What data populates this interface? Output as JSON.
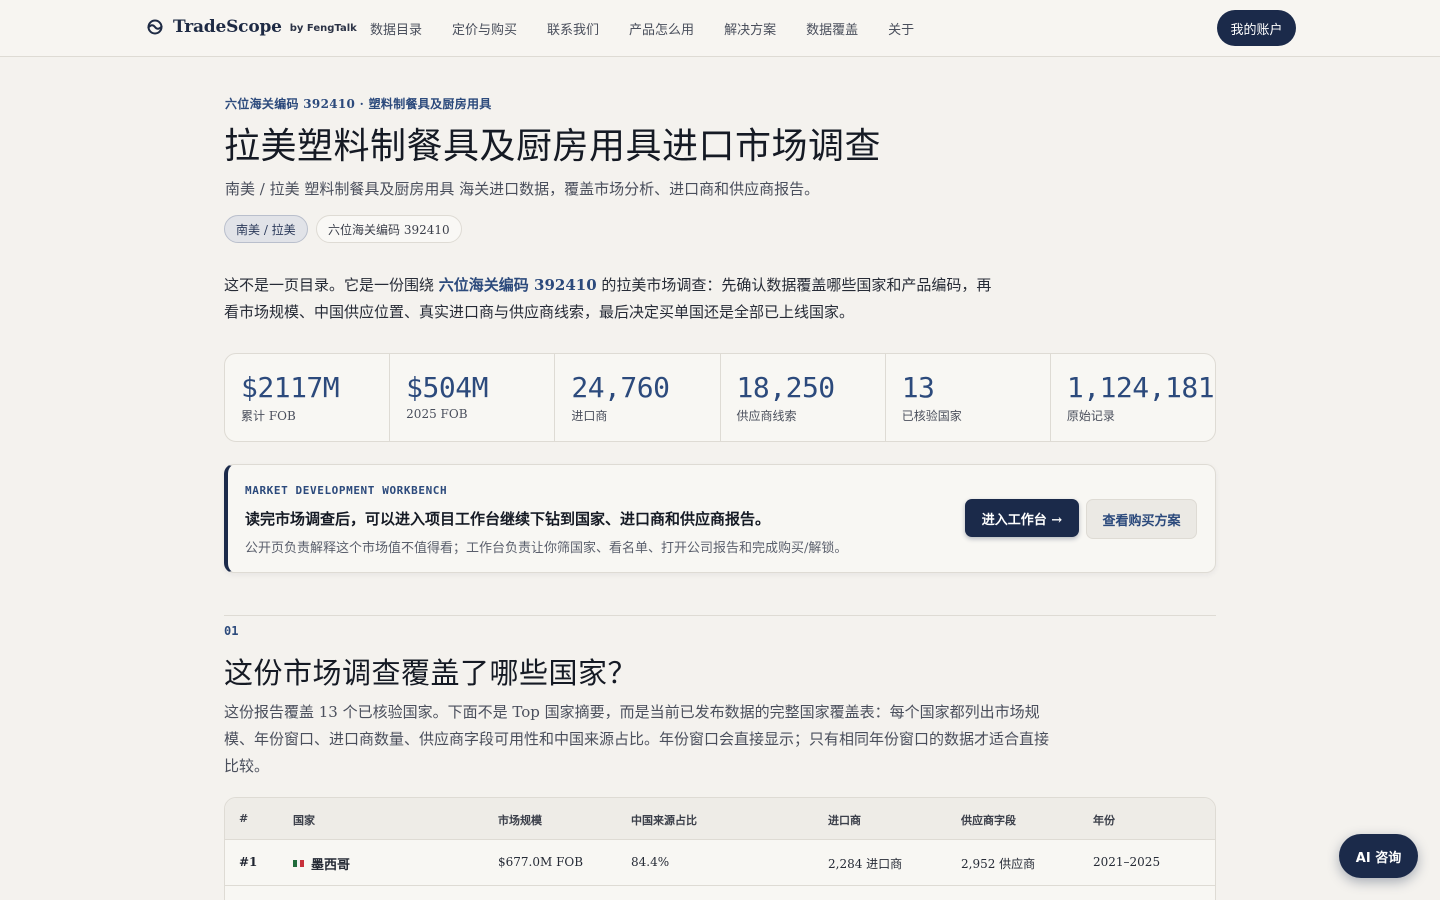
{
  "nav": {
    "brand": "TradeScope",
    "brand_by": "by FengTalk",
    "links": [
      "数据目录",
      "定价与购买",
      "联系我们",
      "产品怎么用",
      "解决方案",
      "数据覆盖",
      "关于"
    ],
    "account": "我的账户"
  },
  "hero": {
    "eyebrow": "六位海关编码 392410 · 塑料制餐具及厨房用具",
    "title": "拉美塑料制餐具及厨房用具进口市场调查",
    "subtitle": "南美 / 拉美 塑料制餐具及厨房用具 海关进口数据，覆盖市场分析、进口商和供应商报告。",
    "chips": [
      "南美 / 拉美",
      "六位海关编码 392410"
    ],
    "intro_before": "这不是一页目录。它是一份围绕 ",
    "intro_highlight": "六位海关编码 392410",
    "intro_after": " 的拉美市场调查：先确认数据覆盖哪些国家和产品编码，再看市场规模、中国供应位置、真实进口商与供应商线索，最后决定买单国还是全部已上线国家。"
  },
  "stats": [
    {
      "value": "$2117M",
      "label": "累计 FOB"
    },
    {
      "value": "$504M",
      "label": "2025 FOB"
    },
    {
      "value": "24,760",
      "label": "进口商"
    },
    {
      "value": "18,250",
      "label": "供应商线索"
    },
    {
      "value": "13",
      "label": "已核验国家"
    },
    {
      "value": "1,124,181",
      "label": "原始记录"
    }
  ],
  "workbench": {
    "tag": "MARKET DEVELOPMENT WORKBENCH",
    "heading": "读完市场调查后，可以进入项目工作台继续下钻到国家、进口商和供应商报告。",
    "desc": "公开页负责解释这个市场值不值得看；工作台负责让你筛国家、看名单、打开公司报告和完成购买/解锁。",
    "enter": "进入工作台 →",
    "plans": "查看购买方案"
  },
  "section": {
    "num": "01",
    "title": "这份市场调查覆盖了哪些国家？",
    "desc": "这份报告覆盖 13 个已核验国家。下面不是 Top 国家摘要，而是当前已发布数据的完整国家覆盖表：每个国家都列出市场规模、年份窗口、进口商数量、供应商字段可用性和中国来源占比。年份窗口会直接显示；只有相同年份窗口的数据才适合直接比较。"
  },
  "table": {
    "headers": [
      "#",
      "国家",
      "市场规模",
      "中国来源占比",
      "进口商",
      "供应商字段",
      "年份"
    ],
    "rows": [
      {
        "rank": "#1",
        "flag": "mexico-flag-icon",
        "country": "墨西哥",
        "market": "$677.0M FOB",
        "china_share": "84.4%",
        "importers": "2,284 进口商",
        "suppliers": "2,952 供应商",
        "years": "2021–2025"
      }
    ]
  },
  "ai_button": "AI 咨询",
  "colors": {
    "accent": "#1b2a4a",
    "link": "#2c4a7c",
    "background": "#f4f2ee"
  }
}
